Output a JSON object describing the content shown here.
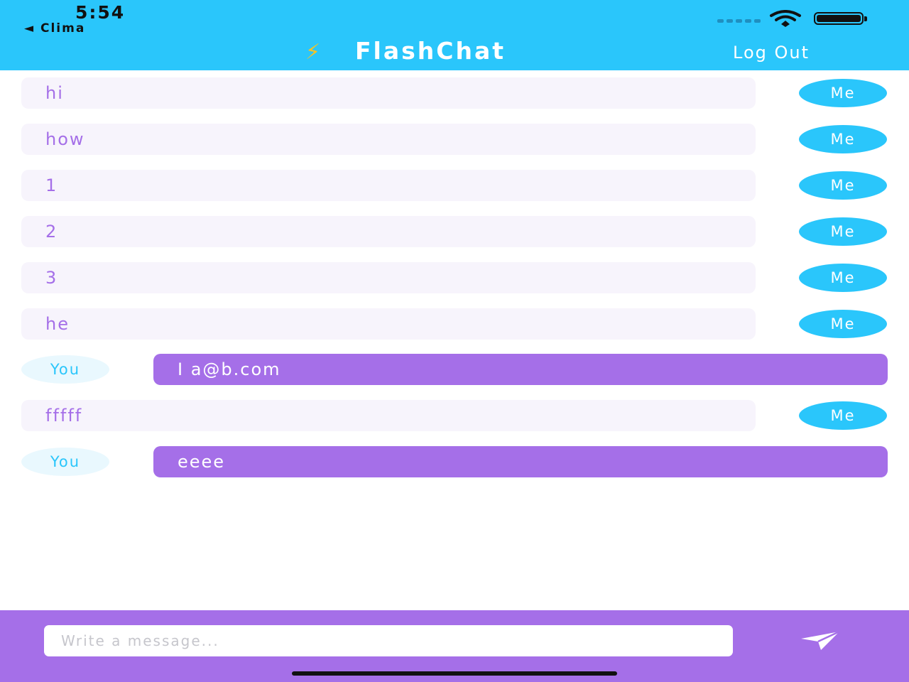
{
  "status_bar": {
    "time": "5:54",
    "back_label": "◄ Clima"
  },
  "header": {
    "bolt": "⚡",
    "title": "FlashChat",
    "logout_label": "Log Out"
  },
  "messages": [
    {
      "sender": "me",
      "text": "hi",
      "avatar": "Me"
    },
    {
      "sender": "me",
      "text": "how",
      "avatar": "Me"
    },
    {
      "sender": "me",
      "text": "1",
      "avatar": "Me"
    },
    {
      "sender": "me",
      "text": "2",
      "avatar": "Me"
    },
    {
      "sender": "me",
      "text": "3",
      "avatar": "Me"
    },
    {
      "sender": "me",
      "text": "he",
      "avatar": "Me"
    },
    {
      "sender": "you",
      "text": "I a@b.com",
      "avatar": "You"
    },
    {
      "sender": "me",
      "text": "fffff",
      "avatar": "Me"
    },
    {
      "sender": "you",
      "text": "eeee",
      "avatar": "You"
    }
  ],
  "composer": {
    "placeholder": "Write a message...",
    "value": ""
  },
  "colors": {
    "header_blue": "#2ac6fb",
    "purple": "#a56fe8",
    "bubble_light": "#f7f4fc",
    "you_avatar_bg": "#e9f8fe"
  },
  "icons": {
    "send": "paper-plane-icon",
    "wifi": "wifi-icon",
    "battery": "battery-icon",
    "signal": "cellular-signal-icon"
  }
}
